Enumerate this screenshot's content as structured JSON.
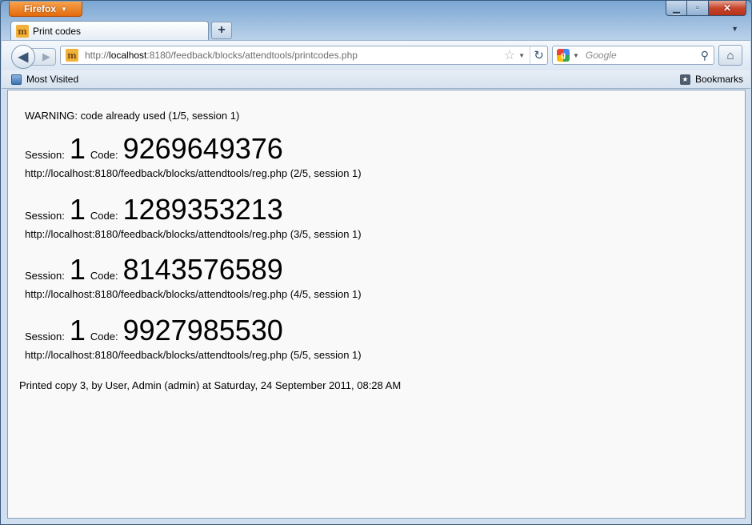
{
  "browser": {
    "menu_button": "Firefox",
    "tab_title": "Print codes",
    "url_prefix": "http://",
    "url_host": "localhost",
    "url_rest": ":8180/feedback/blocks/attendtools/printcodes.php",
    "search_placeholder": "Google",
    "bookmarks_left": "Most Visited",
    "bookmarks_right": "Bookmarks"
  },
  "page": {
    "warning": "WARNING: code already used (1/5, session 1)",
    "session_label": "Session:",
    "code_label": "Code:",
    "entries": [
      {
        "session": "1",
        "code": "9269649376",
        "url": "http://localhost:8180/feedback/blocks/attendtools/reg.php (2/5, session 1)"
      },
      {
        "session": "1",
        "code": "1289353213",
        "url": "http://localhost:8180/feedback/blocks/attendtools/reg.php (3/5, session 1)"
      },
      {
        "session": "1",
        "code": "8143576589",
        "url": "http://localhost:8180/feedback/blocks/attendtools/reg.php (4/5, session 1)"
      },
      {
        "session": "1",
        "code": "9927985530",
        "url": "http://localhost:8180/feedback/blocks/attendtools/reg.php (5/5, session 1)"
      }
    ],
    "footer": "Printed copy 3, by User, Admin (admin) at Saturday, 24 September 2011, 08:28 AM"
  }
}
